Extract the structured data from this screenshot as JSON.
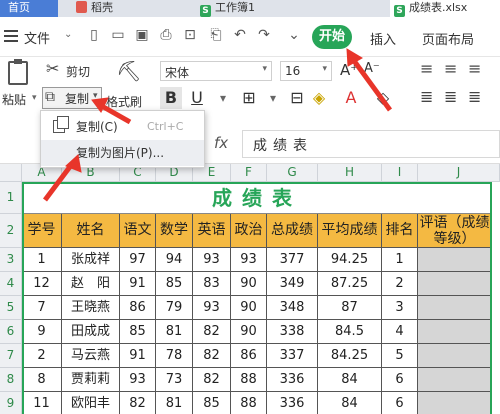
{
  "tabs": [
    {
      "label": "首页"
    },
    {
      "label": "稻壳"
    },
    {
      "label": "工作簿1"
    },
    {
      "label": "成绩表.xlsx"
    }
  ],
  "menubar": {
    "file": "文件",
    "start": "开始",
    "insert": "插入",
    "page_layout": "页面布局"
  },
  "ribbon": {
    "cut": "剪切",
    "paste": "粘贴",
    "copy": "复制",
    "format_painter": "格式刷",
    "font_name": "宋体",
    "font_size": "16",
    "bold": "B"
  },
  "dropdown": {
    "copy_label": "复制(C)",
    "copy_shortcut": "Ctrl+C",
    "copy_as_picture": "复制为图片(P)..."
  },
  "formula_bar": {
    "fx": "fx",
    "value": "成绩表"
  },
  "sheet": {
    "columns": [
      "A",
      "B",
      "C",
      "D",
      "E",
      "F",
      "G",
      "H",
      "I",
      "J"
    ],
    "rows": [
      "1",
      "2",
      "3",
      "4",
      "5",
      "6",
      "7",
      "8",
      "9"
    ],
    "title": "成绩表",
    "headers": [
      "学号",
      "姓名",
      "语文",
      "数学",
      "英语",
      "政治",
      "总成绩",
      "平均成绩",
      "排名",
      "评语（成绩等级）"
    ],
    "data": [
      [
        "1",
        "张成祥",
        "97",
        "94",
        "93",
        "93",
        "377",
        "94.25",
        "1",
        ""
      ],
      [
        "12",
        "赵　阳",
        "91",
        "85",
        "83",
        "90",
        "349",
        "87.25",
        "2",
        ""
      ],
      [
        "7",
        "王晓燕",
        "86",
        "79",
        "93",
        "90",
        "348",
        "87",
        "3",
        ""
      ],
      [
        "9",
        "田成成",
        "85",
        "81",
        "82",
        "90",
        "338",
        "84.5",
        "4",
        ""
      ],
      [
        "2",
        "马云燕",
        "91",
        "78",
        "82",
        "86",
        "337",
        "84.25",
        "5",
        ""
      ],
      [
        "8",
        "贾莉莉",
        "93",
        "73",
        "82",
        "88",
        "336",
        "84",
        "6",
        ""
      ],
      [
        "11",
        "欧阳丰",
        "82",
        "81",
        "85",
        "88",
        "336",
        "84",
        "6",
        ""
      ]
    ]
  },
  "colors": {
    "accent_green": "#27a558",
    "header_fill": "#f4b942",
    "tab_blue": "#4a7dd6",
    "arrow_red": "#e8352a"
  }
}
